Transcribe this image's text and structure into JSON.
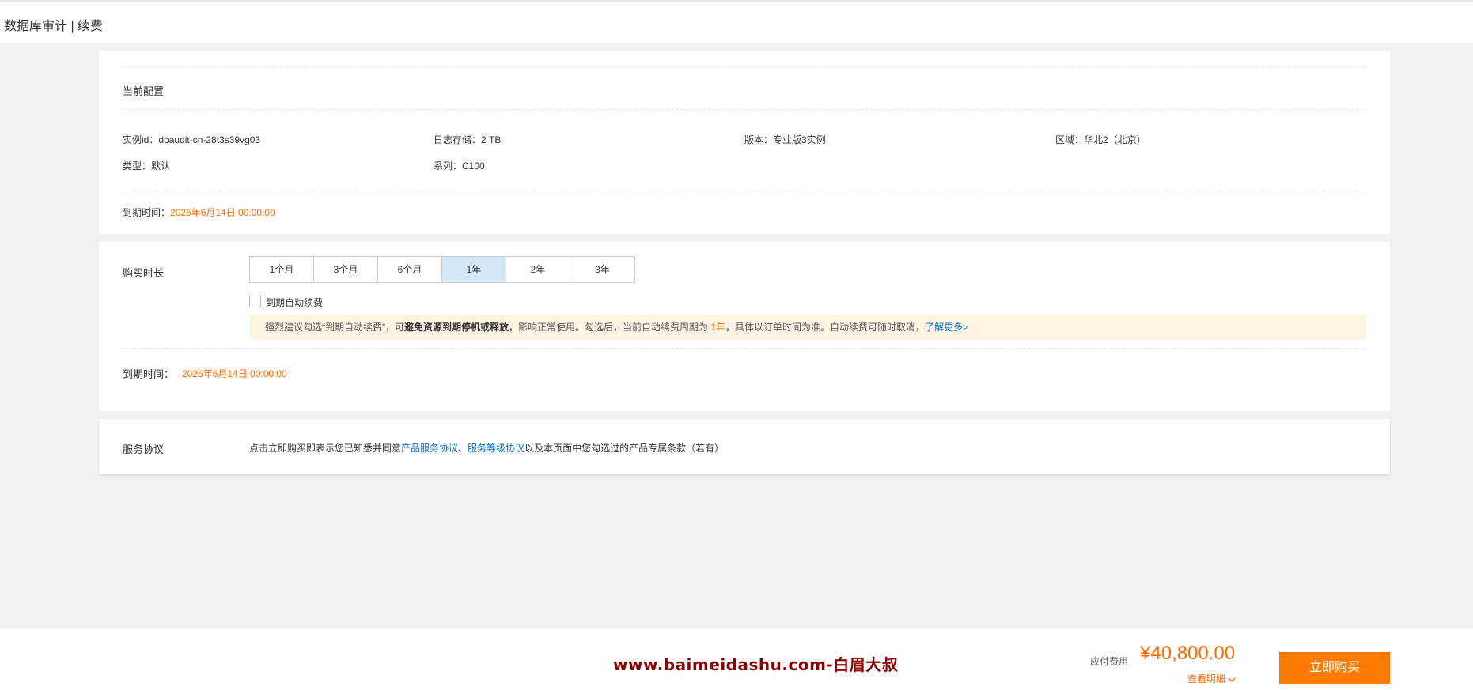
{
  "header": {
    "title": "数据库审计 | 续费"
  },
  "current_config": {
    "section_title": "当前配置",
    "instance_id": "实例id：dbaudit-cn-28t3s39vg03",
    "log_storage": "日志存储：2 TB",
    "edition": "版本：专业版3实例",
    "region": "区域：华北2（北京）",
    "type": "类型：默认",
    "series": "系列：C100",
    "expiry_label": "到期时间：",
    "expiry_value": "2025年6月14日 00:00:00"
  },
  "purchase": {
    "duration_label": "购买时长",
    "periods": [
      "1个月",
      "3个月",
      "6个月",
      "1年",
      "2年",
      "3年"
    ],
    "selected_period": "1年",
    "auto_renew_label": "到期自动续费",
    "notice": {
      "part1": "强烈建议勾选“到期自动续费”，可",
      "bold": "避免资源到期停机或释放",
      "part2": "，影响正常使用。勾选后，当前自动续费周期为 ",
      "period": "1年",
      "part3": "，具体以订单时间为准。自动续费可随时取消，",
      "link": "了解更多>"
    },
    "new_expiry_label": "到期时间：",
    "new_expiry_value": "2026年6月14日 00:00:00"
  },
  "agreement": {
    "label": "服务协议",
    "text1": "点击立即购买即表示您已知悉并同意",
    "link1": "产品服务协议",
    "sep": "、",
    "link2": "服务等级协议",
    "text2": "以及本页面中您勾选过的产品专属条款（若有）"
  },
  "footer": {
    "watermark": "www.baimeidashu.com-白眉大叔",
    "price_label": "应付费用",
    "price": "¥40,800.00",
    "detail_link": "查看明细",
    "buy_button": "立即购买"
  },
  "colors": {
    "accent": "#ff6a00",
    "link": "#0070cc",
    "selected_period_bg": "#d5e6f6",
    "notice_bg": "#fff3e4"
  }
}
